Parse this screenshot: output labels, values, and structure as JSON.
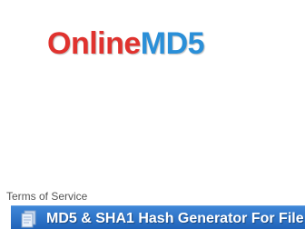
{
  "logo": {
    "part1": "Online",
    "part2": "MD5"
  },
  "tos_link": {
    "label": "Terms of Service"
  },
  "banner": {
    "title": "MD5 & SHA1 Hash Generator For File",
    "icon": "document-icon"
  },
  "colors": {
    "logo_red": "#e0322e",
    "logo_blue": "#2a8fd8",
    "banner_blue": "#2a6fc4"
  }
}
